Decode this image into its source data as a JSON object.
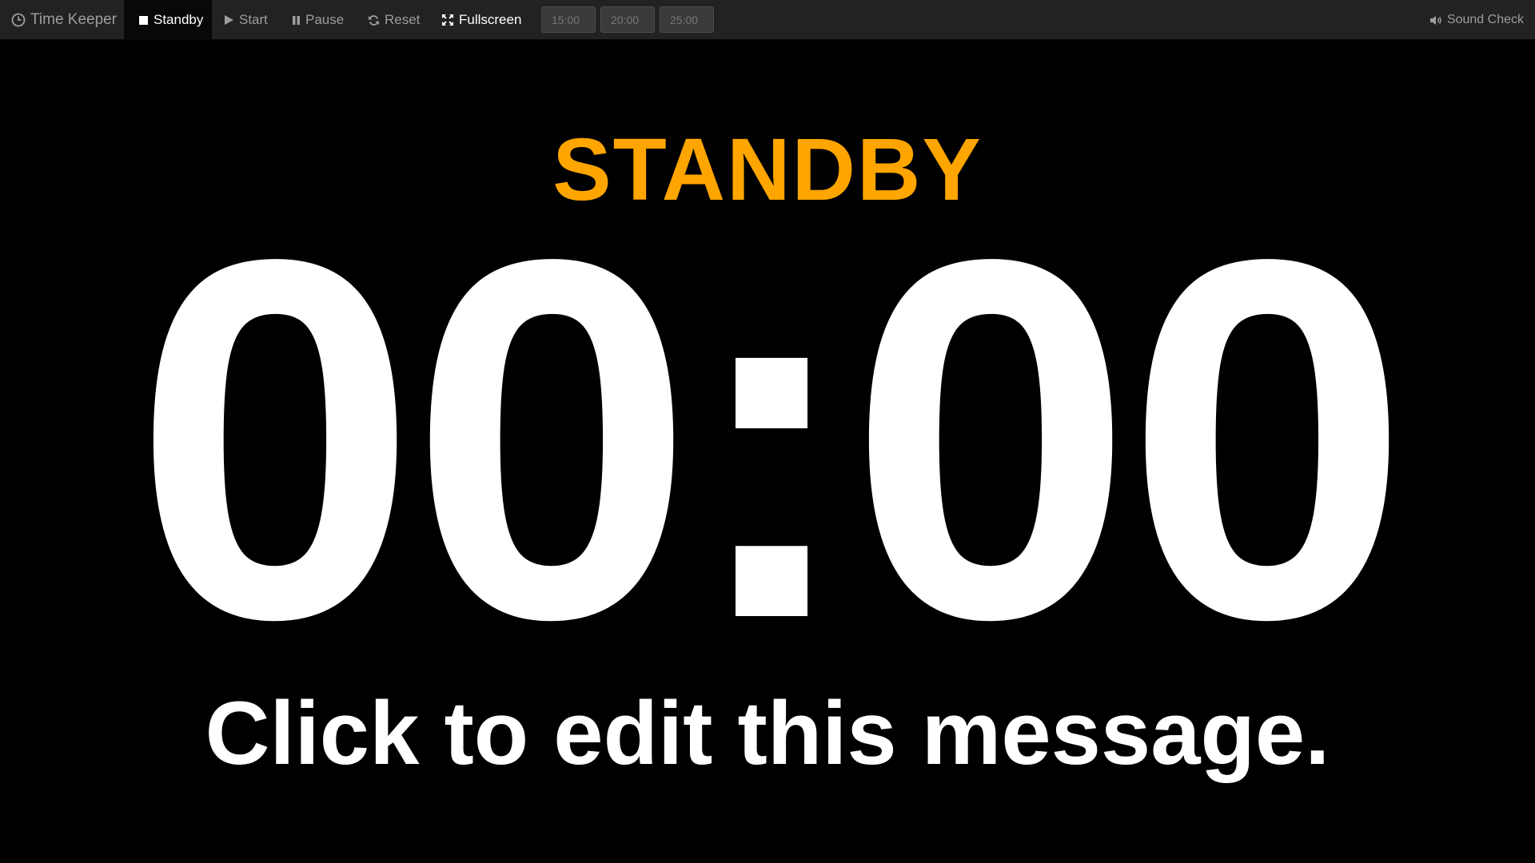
{
  "navbar": {
    "brand": {
      "label": "Time Keeper",
      "icon": "clock-icon"
    },
    "items": [
      {
        "label": "Standby",
        "icon": "stop-square-icon",
        "active": true
      },
      {
        "label": "Start",
        "icon": "play-icon"
      },
      {
        "label": "Pause",
        "icon": "pause-icon"
      },
      {
        "label": "Reset",
        "icon": "refresh-icon"
      },
      {
        "label": "Fullscreen",
        "icon": "fullscreen-icon"
      }
    ],
    "presets": [
      "15:00",
      "20:00",
      "25:00"
    ],
    "sound_check": {
      "label": "Sound Check",
      "icon": "volume-icon"
    }
  },
  "display": {
    "status": "STANDBY",
    "time": "00:00",
    "message": "Click to edit this message."
  },
  "colors": {
    "navbar_bg": "#222222",
    "background": "#000000",
    "status": "#FFA500",
    "text": "#FFFFFF"
  }
}
